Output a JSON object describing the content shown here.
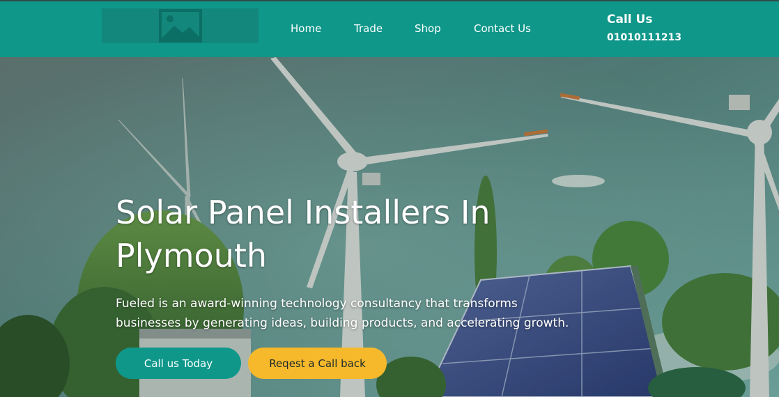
{
  "header": {
    "logo_icon": "image-placeholder-icon",
    "nav": [
      {
        "label": "Home"
      },
      {
        "label": "Trade"
      },
      {
        "label": "Shop"
      },
      {
        "label": "Contact Us"
      }
    ],
    "call_label": "Call Us",
    "call_number": "01010111213"
  },
  "hero": {
    "title_line1": "Solar Panel Installers In",
    "title_line2": "Plymouth",
    "description_line1": "Fueled is an award-winning technology consultancy that transforms",
    "description_line2": "businesses by generating ideas, building products, and accelerating growth.",
    "primary_button": "Call us Today",
    "secondary_button": "Reqest a Call back"
  },
  "colors": {
    "brand_teal": "#0f978a",
    "accent_yellow": "#f6b92b",
    "text_white": "#ffffff"
  }
}
